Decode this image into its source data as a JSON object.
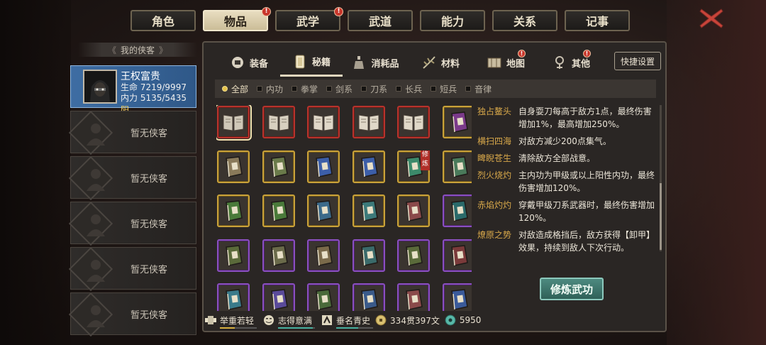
{
  "top_tabs": [
    {
      "label": "角色",
      "active": false,
      "badge": false
    },
    {
      "label": "物品",
      "active": true,
      "badge": true
    },
    {
      "label": "武学",
      "active": false,
      "badge": true
    },
    {
      "label": "武道",
      "active": false,
      "badge": false
    },
    {
      "label": "能力",
      "active": false,
      "badge": false
    },
    {
      "label": "关系",
      "active": false,
      "badge": false
    },
    {
      "label": "记事",
      "active": false,
      "badge": false
    }
  ],
  "badge_mark": "!",
  "sidebar": {
    "header": "我的侠客",
    "active_hero": {
      "name": "王权富贵",
      "hp_label": "生命",
      "hp": "7219/9997",
      "mp_label": "内力",
      "mp": "5135/5435",
      "mp_type": "阳"
    },
    "empty_slots": [
      "暂无侠客",
      "暂无侠客",
      "暂无侠客",
      "暂无侠客",
      "暂无侠客"
    ]
  },
  "sub_tabs": [
    {
      "label": "装备",
      "icon": "equipment-icon",
      "active": false,
      "badge": false
    },
    {
      "label": "秘籍",
      "icon": "manual-icon",
      "active": true,
      "badge": false
    },
    {
      "label": "消耗品",
      "icon": "potion-icon",
      "active": false,
      "badge": false
    },
    {
      "label": "材料",
      "icon": "herb-icon",
      "active": false,
      "badge": false
    },
    {
      "label": "地图",
      "icon": "map-icon",
      "active": false,
      "badge": true
    },
    {
      "label": "其他",
      "icon": "other-icon",
      "active": false,
      "badge": true
    }
  ],
  "quick_settings": "快捷设置",
  "filters": [
    {
      "label": "全部",
      "active": true
    },
    {
      "label": "内功",
      "active": false
    },
    {
      "label": "拳掌",
      "active": false
    },
    {
      "label": "剑系",
      "active": false
    },
    {
      "label": "刀系",
      "active": false
    },
    {
      "label": "长兵",
      "active": false
    },
    {
      "label": "短兵",
      "active": false
    },
    {
      "label": "音律",
      "active": false
    }
  ],
  "item_grid": [
    [
      "red",
      "red",
      "red",
      "red",
      "red",
      "gold"
    ],
    [
      "gold",
      "gold",
      "gold",
      "gold",
      "gold",
      "gold"
    ],
    [
      "gold",
      "gold",
      "gold",
      "gold",
      "gold",
      "purple"
    ],
    [
      "purple",
      "purple",
      "purple",
      "purple",
      "purple",
      "purple"
    ],
    [
      "purple",
      "purple",
      "purple",
      "purple",
      "purple",
      "purple"
    ]
  ],
  "book_colors": [
    [
      "#cfc8b8",
      "#d8d0c0",
      "#e0d8c8",
      "#e0d8c8",
      "#e0d8c8",
      "#7b3a8a"
    ],
    [
      "#8a7a5a",
      "#6a7a4a",
      "#3c5ea8",
      "#3c5ea8",
      "#3c8a6a",
      "#4a7a5a"
    ],
    [
      "#4a7a3a",
      "#4a7a3a",
      "#3c6a8a",
      "#3c7a7a",
      "#8a4a4a",
      "#2a6a6a"
    ],
    [
      "#5a6a3a",
      "#6a6a4a",
      "#7a6a4a",
      "#3a6a6a",
      "#5a6a3a",
      "#7a3a3a"
    ],
    [
      "#3a7a8a",
      "#5a4a9a",
      "#4a6a3a",
      "#3a5a8a",
      "#8a4a4a",
      "#3a5a9a"
    ]
  ],
  "selected_slot": [
    0,
    0
  ],
  "train_tag": "修炼",
  "details": [
    {
      "name": "独占鳌头",
      "desc": "自身耍刀每高于敌方1点，最终伤害增加1%，最高增加250%。"
    },
    {
      "name": "横扫四海",
      "desc": "对敌方减少200点集气。"
    },
    {
      "name": "睥睨苍生",
      "desc": "清除敌方全部战意。"
    },
    {
      "name": "烈火烧灼",
      "desc": "主内功为甲级或以上阳性内功，最终伤害增加120%。"
    },
    {
      "name": "赤焰灼灼",
      "desc": "穿戴甲级刀系武器时，最终伤害增加120%。"
    },
    {
      "name": "燎原之势",
      "desc": "对敌造成格挡后，敌方获得【卸甲】效果，持续到敌人下次行动。"
    }
  ],
  "train_button": "修炼武功",
  "status": [
    {
      "label": "举重若轻",
      "icon": "strength-icon",
      "bar_color": "#d8b040",
      "fill": 0.4
    },
    {
      "label": "志得意满",
      "icon": "mood-icon",
      "bar_color": "#48b0a0",
      "fill": 0.95
    },
    {
      "label": "垂名青史",
      "icon": "fame-icon",
      "bar_color": "#48b0a0",
      "fill": 0.6
    },
    {
      "label": "334贯397文",
      "icon": "coin-icon"
    },
    {
      "label": "5950",
      "icon": "jade-icon"
    }
  ]
}
